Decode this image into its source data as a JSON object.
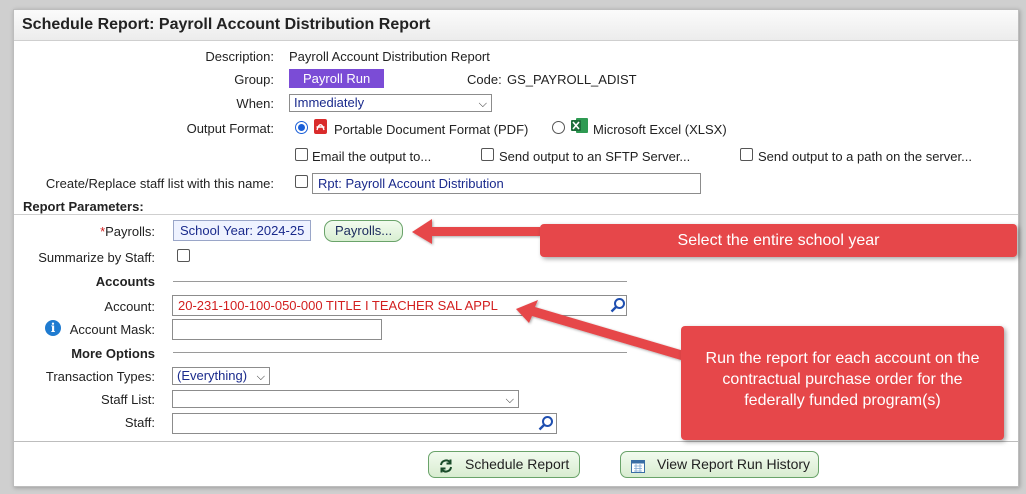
{
  "header": {
    "title": "Schedule Report: Payroll Account Distribution Report"
  },
  "form": {
    "description_label": "Description:",
    "description_value": "Payroll Account Distribution Report",
    "group_label": "Group:",
    "group_value": "Payroll Run",
    "code_label": "Code:",
    "code_value": "GS_PAYROLL_ADIST",
    "when_label": "When:",
    "when_value": "Immediately",
    "output_label": "Output Format:",
    "pdf_label": "Portable Document Format (PDF)",
    "xlsx_label": "Microsoft Excel (XLSX)",
    "email_label": "Email the output to...",
    "sftp_label": "Send output to an SFTP Server...",
    "path_label": "Send output to a path on the server...",
    "staff_list_label": "Create/Replace staff list with this name:",
    "staff_list_value": "Rpt: Payroll Account Distribution"
  },
  "params": {
    "section_title": "Report Parameters:",
    "payrolls_req": "*",
    "payrolls_label": "Payrolls:",
    "payrolls_chip": "School Year: 2024-25",
    "payrolls_button": "Payrolls...",
    "summarize_label": "Summarize by Staff:",
    "accounts_header": "Accounts",
    "account_label": "Account:",
    "account_value": "20-231-100-100-050-000 TITLE I TEACHER SAL APPL",
    "mask_label": "Account Mask:",
    "more_header": "More Options",
    "trans_label": "Transaction Types:",
    "trans_value": "(Everything)",
    "stafflist_label": "Staff List:",
    "staff_label": "Staff:"
  },
  "buttons": {
    "schedule": "Schedule Report",
    "history": "View Report Run History"
  },
  "callouts": {
    "one": "Select the entire school year",
    "two": "Run the report for each account on the contractual purchase order for the federally funded program(s)"
  },
  "colors": {
    "accent_purple": "#7b4cd6",
    "callout_red": "#e6474a",
    "required_red": "#d21f1f"
  }
}
